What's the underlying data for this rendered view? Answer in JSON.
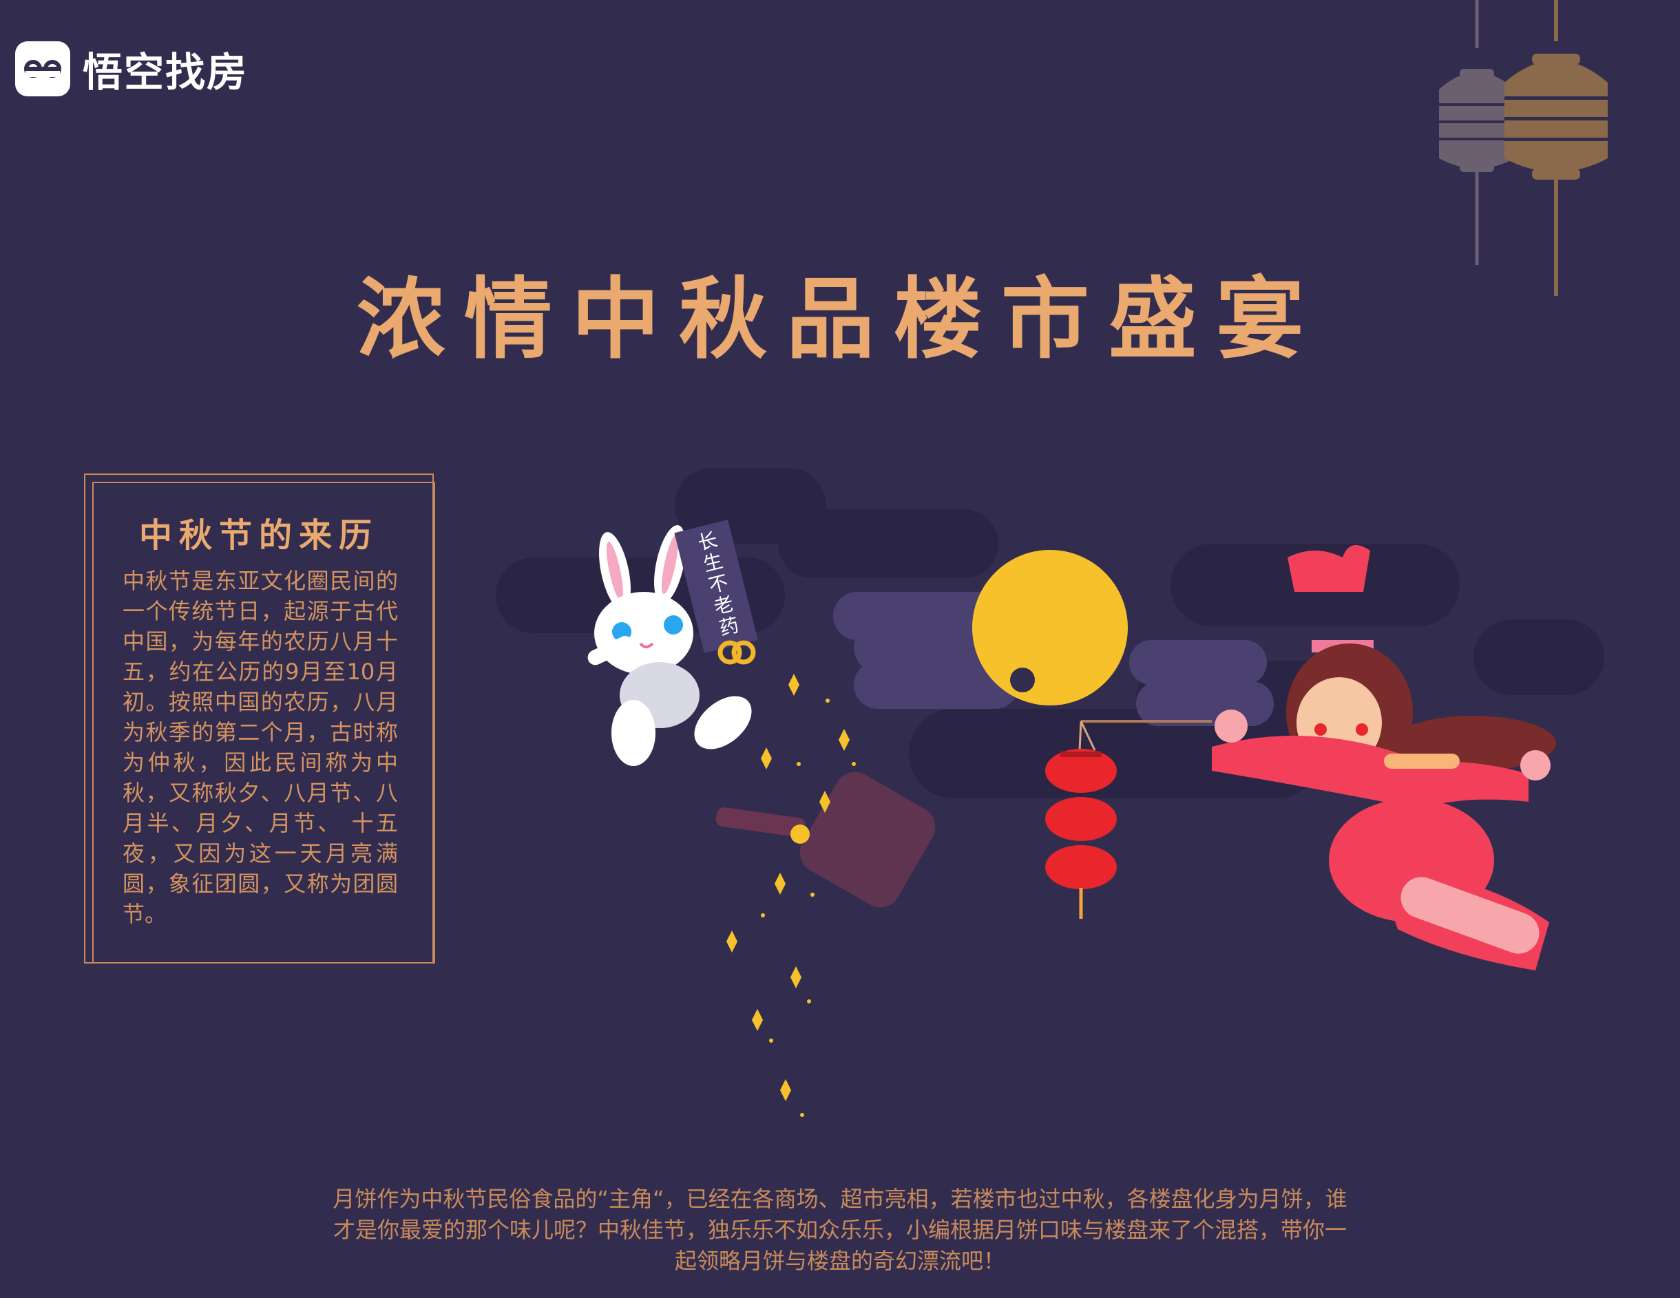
{
  "brand": {
    "name": "悟空找房",
    "logo_icon": "eyes-logo-icon"
  },
  "headline": "浓情中秋品楼市盛宴",
  "history": {
    "title": "中秋节的来历",
    "body": "中秋节是东亚文化圈民间的一个传统节日，起源于古代中国，为每年的农历八月十五，约在公历的9月至10月初。按照中国的农历，八月为秋季的第二个月，古时称为仲秋，因此民间称为中秋，又称秋夕、八月节、八月半、月夕、月节、 十五夜，又因为这一天月亮满圆，象征团圆，又称为团圆节。"
  },
  "illustration": {
    "banner_text": "长生不老药",
    "icons": [
      "rabbit-icon",
      "elixir-banner-icon",
      "moon-icon",
      "cloud-icon",
      "red-lantern-icon",
      "change-fairy-icon",
      "hanging-lanterns-icon",
      "sparkle-icon",
      "bowl-icon"
    ]
  },
  "intro": "月饼作为中秋节民俗食品的“主角“，已经在各商场、超市亮相，若楼市也过中秋，各楼盘化身为月饼，谁才是你最爱的那个味儿呢？中秋佳节，独乐乐不如众乐乐，小编根据月饼口味与楼盘来了个混搭，带你一起领略月饼与楼盘的奇幻漂流吧！",
  "colors": {
    "background": "#322d4f",
    "accent": "#eaa96f",
    "moon": "#f7c12b",
    "lantern_red": "#e8262b",
    "fairy_pink": "#f2405b"
  }
}
